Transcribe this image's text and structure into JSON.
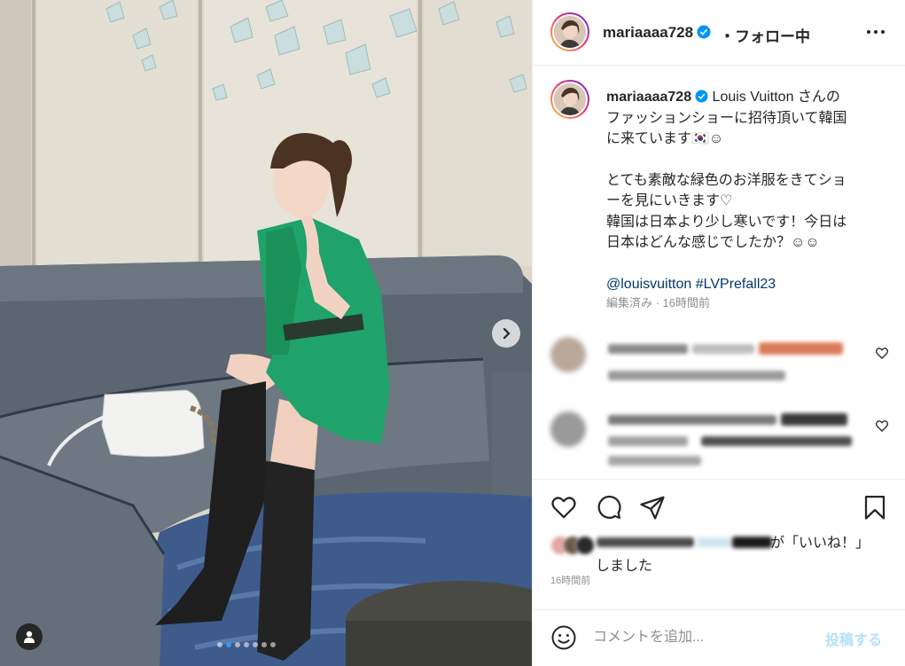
{
  "post": {
    "username": "mariaaaa728",
    "separator": "・",
    "follow_status": "フォロー中",
    "more_icon": "more-horizontal-icon",
    "carousel": {
      "slide_count": 7,
      "active_index": 1
    }
  },
  "caption": {
    "username": "mariaaaa728",
    "lines": [
      "Louis Vuitton さんの",
      "ファッションショーに招待頂いて韓国",
      "に来ています🇰🇷☺︎"
    ],
    "lines2": [
      "とても素敵な緑色のお洋服をきてショ",
      "ーを見にいきます♡",
      "韓国は日本より少し寒いです！今日は",
      "日本はどんな感じでしたか？☺︎☺︎"
    ],
    "tags": "@louisvuitton #LVPrefall23",
    "meta": "編集済み · 16時間前"
  },
  "liked_by": {
    "text_suffix": "が「いいね！」",
    "text_line2": "しました"
  },
  "time_ago": "16時間前",
  "add_comment": {
    "placeholder": "コメントを追加...",
    "post_label": "投稿する"
  },
  "colors": {
    "accent": "#0095f6",
    "post_disabled": "#b2dffc",
    "hashtag": "#00376b",
    "dress_green": "#1fa36a"
  }
}
